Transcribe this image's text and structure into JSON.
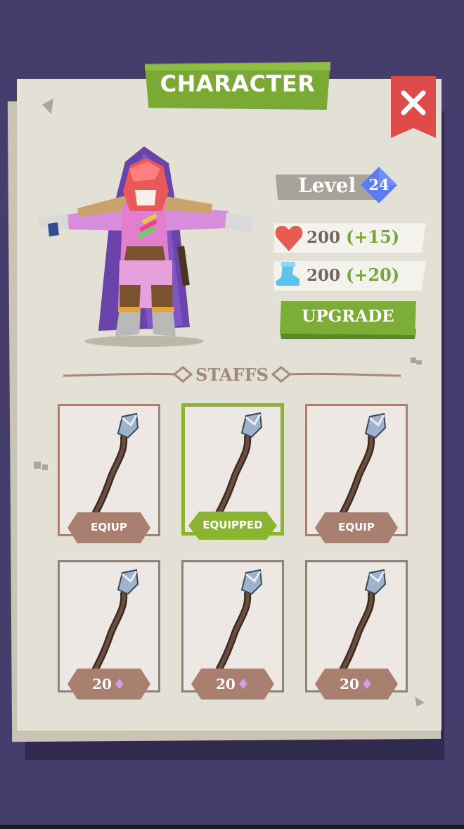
{
  "title": "CHARACTER",
  "level": {
    "label": "Level",
    "value": "24"
  },
  "stats": {
    "health": {
      "value": "200",
      "bonus": "(+15)",
      "icon": "heart-icon"
    },
    "speed": {
      "value": "200",
      "bonus": "(+20)",
      "icon": "boot-icon"
    }
  },
  "upgrade_label": "UPGRADE",
  "section_title": "STAFFS",
  "staffs": [
    {
      "label": "EQIUP",
      "state": "equip"
    },
    {
      "label": "EQUIPPED",
      "state": "equipped"
    },
    {
      "label": "EQUIP",
      "state": "equip"
    },
    {
      "price": "20",
      "state": "locked"
    },
    {
      "price": "20",
      "state": "locked"
    },
    {
      "price": "20",
      "state": "locked"
    }
  ],
  "colors": {
    "background": "#453d6b",
    "panel": "#e3e0d5",
    "accent_green": "#7aaa34",
    "close_red": "#dd4b4b",
    "level_badge": "#5b7cf2",
    "card_border": "#a9806f",
    "gem": "#d79bf0"
  }
}
